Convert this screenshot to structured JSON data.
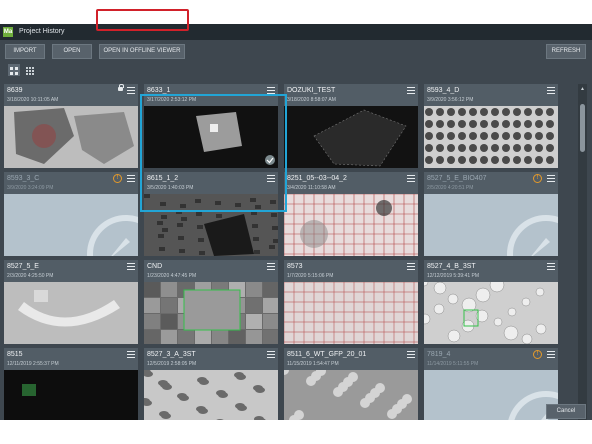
{
  "window": {
    "app_icon": "Ma",
    "title": "Project History"
  },
  "toolbar": {
    "import": "IMPORT",
    "open": "OPEN",
    "offline": "OPEN IN OFFLINE VIEWER",
    "refresh": "REFRESH"
  },
  "view_icons": [
    "grid-large-icon",
    "grid-small-icon"
  ],
  "cards": [
    {
      "name": "8639",
      "date": "3/18/2020 10:11:05 AM",
      "lock": true
    },
    {
      "name": "8633_1",
      "date": "3/17/2020 2:53:12 PM",
      "check": true
    },
    {
      "name": "DOZUKI_TEST",
      "date": "3/18/2020 8:58:07 AM"
    },
    {
      "name": "8593_4_D",
      "date": "3/9/2020 3:56:12 PM"
    },
    {
      "name": "8593_3_C",
      "date": "3/9/2020 3:24:09 PM",
      "warn": true,
      "offline": true
    },
    {
      "name": "8615_1_2",
      "date": "3/5/2020 1:40:03 PM"
    },
    {
      "name": "8251_05--03--04_2",
      "date": "3/4/2020 11:10:58 AM"
    },
    {
      "name": "8527_5_E_BIO407",
      "date": "2/5/2020 4:20:51 PM",
      "warn": true,
      "offline": true
    },
    {
      "name": "8527_5_E",
      "date": "2/3/2020 4:25:50 PM"
    },
    {
      "name": "CND",
      "date": "1/23/2020 4:47:45 PM"
    },
    {
      "name": "8573",
      "date": "1/7/2020 5:15:06 PM"
    },
    {
      "name": "8527_4_B_3ST",
      "date": "12/12/2019 5:39:41 PM"
    },
    {
      "name": "8515",
      "date": "12/11/2019 2:55:37 PM"
    },
    {
      "name": "8527_3_A_3ST",
      "date": "12/5/2019 2:58:05 PM"
    },
    {
      "name": "8511_6_WT_GFP_20_01",
      "date": "11/15/2019 1:54:47 PM"
    },
    {
      "name": "7819_4",
      "date": "11/14/2019 5:11:55 PM",
      "warn": true,
      "offline": true
    }
  ],
  "footer": {
    "cancel": "Cancel"
  },
  "colors": {
    "window_bg": "#3e474f",
    "card_bg": "#525d66",
    "highlight_red": "#d1212a",
    "highlight_blue": "#22a5d6",
    "warning": "#e59a2a"
  }
}
